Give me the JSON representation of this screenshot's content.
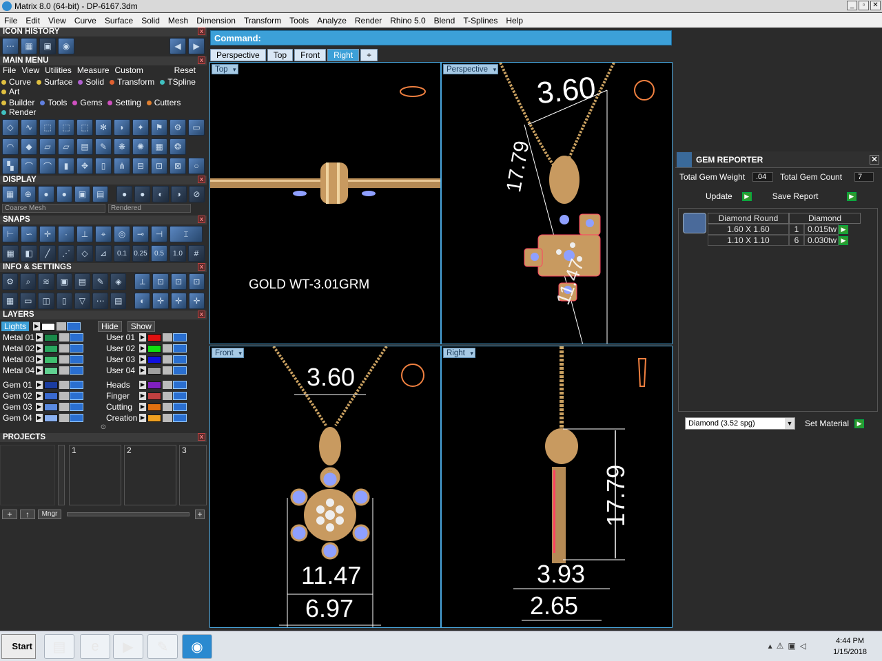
{
  "window": {
    "title": "Matrix 8.0 (64-bit) - DP-6167.3dm"
  },
  "menubar": [
    "File",
    "Edit",
    "View",
    "Curve",
    "Surface",
    "Solid",
    "Mesh",
    "Dimension",
    "Transform",
    "Tools",
    "Analyze",
    "Render",
    "Rhino 5.0",
    "Blend",
    "T-Splines",
    "Help"
  ],
  "sections": {
    "icon_history": "ICON HISTORY",
    "main_menu": "MAIN MENU",
    "display": "DISPLAY",
    "snaps": "SNAPS",
    "info_settings": "INFO & SETTINGS",
    "layers": "LAYERS",
    "projects": "PROJECTS"
  },
  "main_menu": {
    "links": [
      "File",
      "View",
      "Utilities",
      "Measure",
      "Custom"
    ],
    "reset": "Reset",
    "tabs_row1": [
      {
        "label": "Curve",
        "color": "#e0c040"
      },
      {
        "label": "Surface",
        "color": "#e0c040"
      },
      {
        "label": "Solid",
        "color": "#b060d0"
      },
      {
        "label": "Transform",
        "color": "#e06030"
      },
      {
        "label": "TSpline",
        "color": "#40c0c0"
      },
      {
        "label": "Art",
        "color": "#e0c040"
      }
    ],
    "tabs_row2": [
      {
        "label": "Builder",
        "color": "#e0c040"
      },
      {
        "label": "Tools",
        "color": "#6080e0"
      },
      {
        "label": "Gems",
        "color": "#d050c0"
      },
      {
        "label": "Setting",
        "color": "#d050c0"
      },
      {
        "label": "Cutters",
        "color": "#e08030"
      },
      {
        "label": "Render",
        "color": "#40c0c0"
      }
    ]
  },
  "display": {
    "mesh": "Coarse Mesh",
    "render_mode": "Rendered"
  },
  "snaps": {
    "values": [
      "0.1",
      "0.25",
      "0.5",
      "1.0"
    ]
  },
  "layers": {
    "lights": "Lights",
    "hide": "Hide",
    "show": "Show",
    "left": [
      {
        "name": "Metal 01",
        "color": "#1a8a4a"
      },
      {
        "name": "Metal 02",
        "color": "#2aa860"
      },
      {
        "name": "Metal 03",
        "color": "#40c070"
      },
      {
        "name": "Metal 04",
        "color": "#60d090"
      },
      {
        "name": "Gem 01",
        "color": "#1a3ca0"
      },
      {
        "name": "Gem 02",
        "color": "#3a6ad0"
      },
      {
        "name": "Gem 03",
        "color": "#5a8ae0"
      },
      {
        "name": "Gem 04",
        "color": "#8ab0f0"
      }
    ],
    "right": [
      {
        "name": "User 01",
        "color": "#e01010"
      },
      {
        "name": "User 02",
        "color": "#10e010"
      },
      {
        "name": "User 03",
        "color": "#1010e0"
      },
      {
        "name": "User 04",
        "color": "#a0a0a0"
      },
      {
        "name": "Heads",
        "color": "#8020c0"
      },
      {
        "name": "Finger",
        "color": "#c04040"
      },
      {
        "name": "Cutting",
        "color": "#e07010"
      },
      {
        "name": "Creation",
        "color": "#f0a020"
      }
    ]
  },
  "projects": {
    "slots": [
      "1",
      "2",
      "3"
    ],
    "manager": "Mngr"
  },
  "command": {
    "label": "Command:"
  },
  "viewport_tabs": [
    "Perspective",
    "Top",
    "Front",
    "Right",
    "+"
  ],
  "viewports": {
    "top": {
      "label": "Top",
      "note": "GOLD WT-3.01GRM"
    },
    "perspective": {
      "label": "Perspective",
      "dims": [
        "3.60",
        "17.79",
        "11.47"
      ]
    },
    "front": {
      "label": "Front",
      "dims": [
        "3.60",
        "11.47",
        "6.97"
      ]
    },
    "right": {
      "label": "Right",
      "dims": [
        "17.79",
        "3.93",
        "2.65"
      ]
    }
  },
  "gem_reporter": {
    "title": "GEM REPORTER",
    "total_weight_label": "Total Gem Weight",
    "total_weight": ".04",
    "total_count_label": "Total Gem Count",
    "total_count": "7",
    "update": "Update",
    "save_report": "Save Report",
    "table_headers": [
      "Diamond Round",
      "Diamond"
    ],
    "rows": [
      {
        "size": "1.60 X 1.60",
        "qty": "1",
        "tw": "0.015tw"
      },
      {
        "size": "1.10 X 1.10",
        "qty": "6",
        "tw": "0.030tw"
      }
    ],
    "material": "Diamond    (3.52 spg)",
    "set_material": "Set Material"
  },
  "taskbar": {
    "start": "Start",
    "time": "4:44 PM",
    "date": "1/15/2018"
  }
}
